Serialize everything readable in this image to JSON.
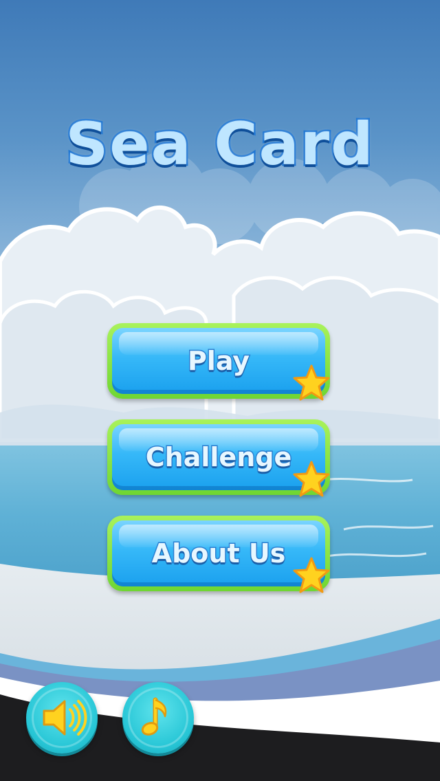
{
  "game": {
    "title": "Sea Card"
  },
  "menu": {
    "play_label": "Play",
    "challenge_label": "Challenge",
    "about_label": "About Us"
  },
  "controls": {
    "sound_icon": "speaker-icon",
    "music_icon": "music-note-icon"
  },
  "colors": {
    "button_blue": "#36b8f8",
    "button_border_green": "#6fd632",
    "title_fill": "#bfe6ff",
    "title_stroke": "#1b74d3",
    "star_gold": "#ffd21f",
    "round_button_cyan": "#27c6d6"
  }
}
